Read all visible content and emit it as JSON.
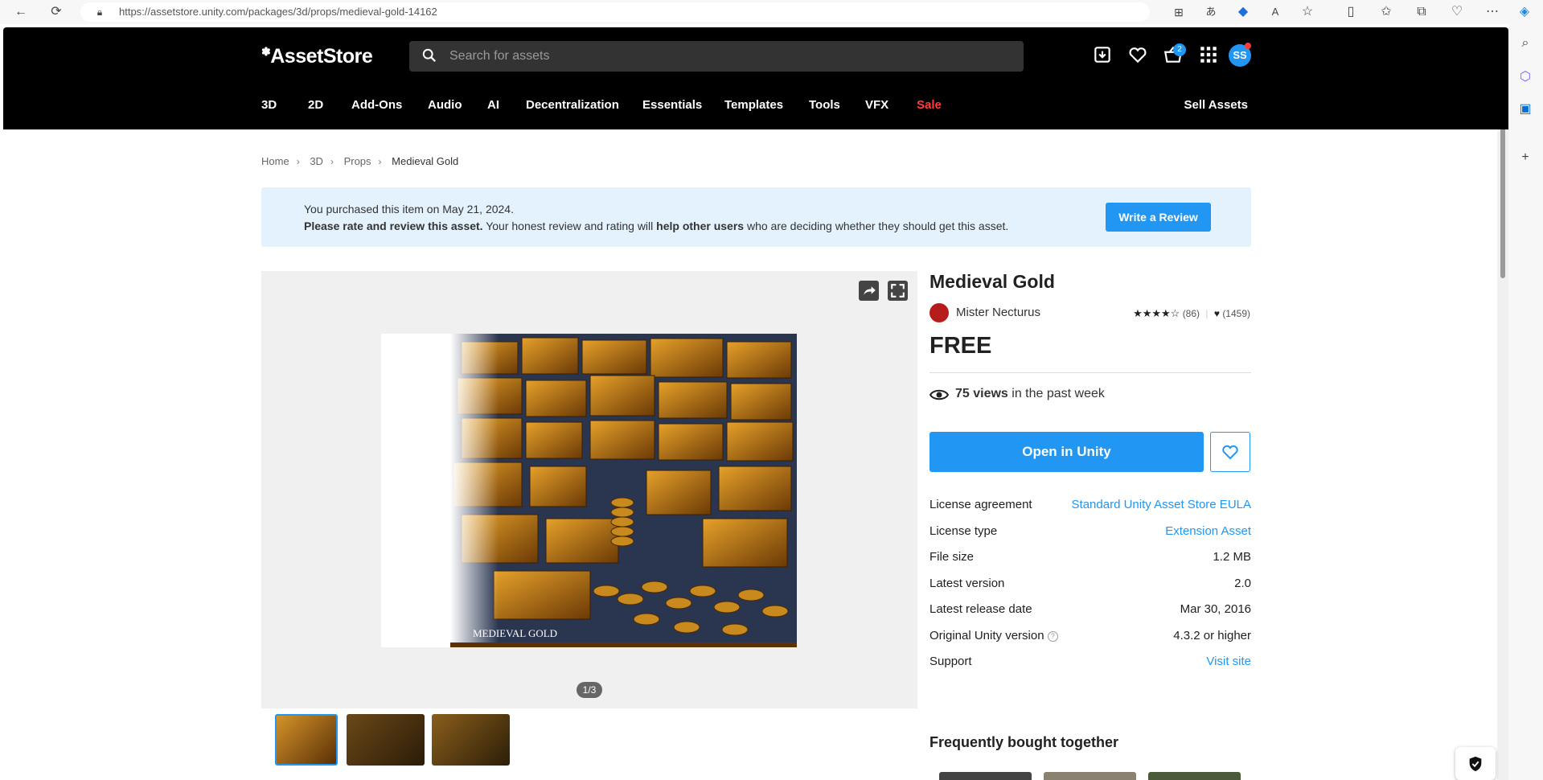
{
  "browser": {
    "url": "https://assetstore.unity.com/packages/3d/props/medieval-gold-14162"
  },
  "header": {
    "logo": "AssetStore",
    "search_placeholder": "Search for assets",
    "cart_count": "2",
    "avatar_initials": "SS",
    "nav": [
      "3D",
      "2D",
      "Add-Ons",
      "Audio",
      "AI",
      "Decentralization",
      "Essentials",
      "Templates",
      "Tools",
      "VFX",
      "Sale"
    ],
    "sell_assets": "Sell Assets",
    "sale_color": "#ff3b3b"
  },
  "breadcrumb": [
    "Home",
    "3D",
    "Props",
    "Medieval Gold"
  ],
  "notice": {
    "line1": "You purchased this item on May 21, 2024.",
    "line2_bold1": "Please rate and review this asset.",
    "line2_text1": " Your honest review and rating will ",
    "line2_bold2": "help other users",
    "line2_text2": " who are deciding whether they should get this asset.",
    "button": "Write a Review"
  },
  "gallery": {
    "image_caption": "MEDIEVAL GOLD",
    "pager": "1/3"
  },
  "product": {
    "title": "Medieval Gold",
    "publisher": "Mister Necturus",
    "rating_stars": 4,
    "rating_count": "(86)",
    "favorites": "(1459)",
    "price": "FREE",
    "views_bold": "75 views",
    "views_text": " in the past week",
    "open_button": "Open in Unity",
    "accent": "#2196f3"
  },
  "details": [
    {
      "label": "License agreement",
      "value": "Standard Unity Asset Store EULA",
      "link": true
    },
    {
      "label": "License type",
      "value": "Extension Asset",
      "link": true
    },
    {
      "label": "File size",
      "value": "1.2 MB",
      "link": false
    },
    {
      "label": "Latest version",
      "value": "2.0",
      "link": false
    },
    {
      "label": "Latest release date",
      "value": "Mar 30, 2016",
      "link": false
    },
    {
      "label": "Original Unity version",
      "value": "4.3.2 or higher",
      "link": false
    },
    {
      "label": "Support",
      "value": "Visit site",
      "link": true
    }
  ],
  "frequently_bought": "Frequently bought together"
}
